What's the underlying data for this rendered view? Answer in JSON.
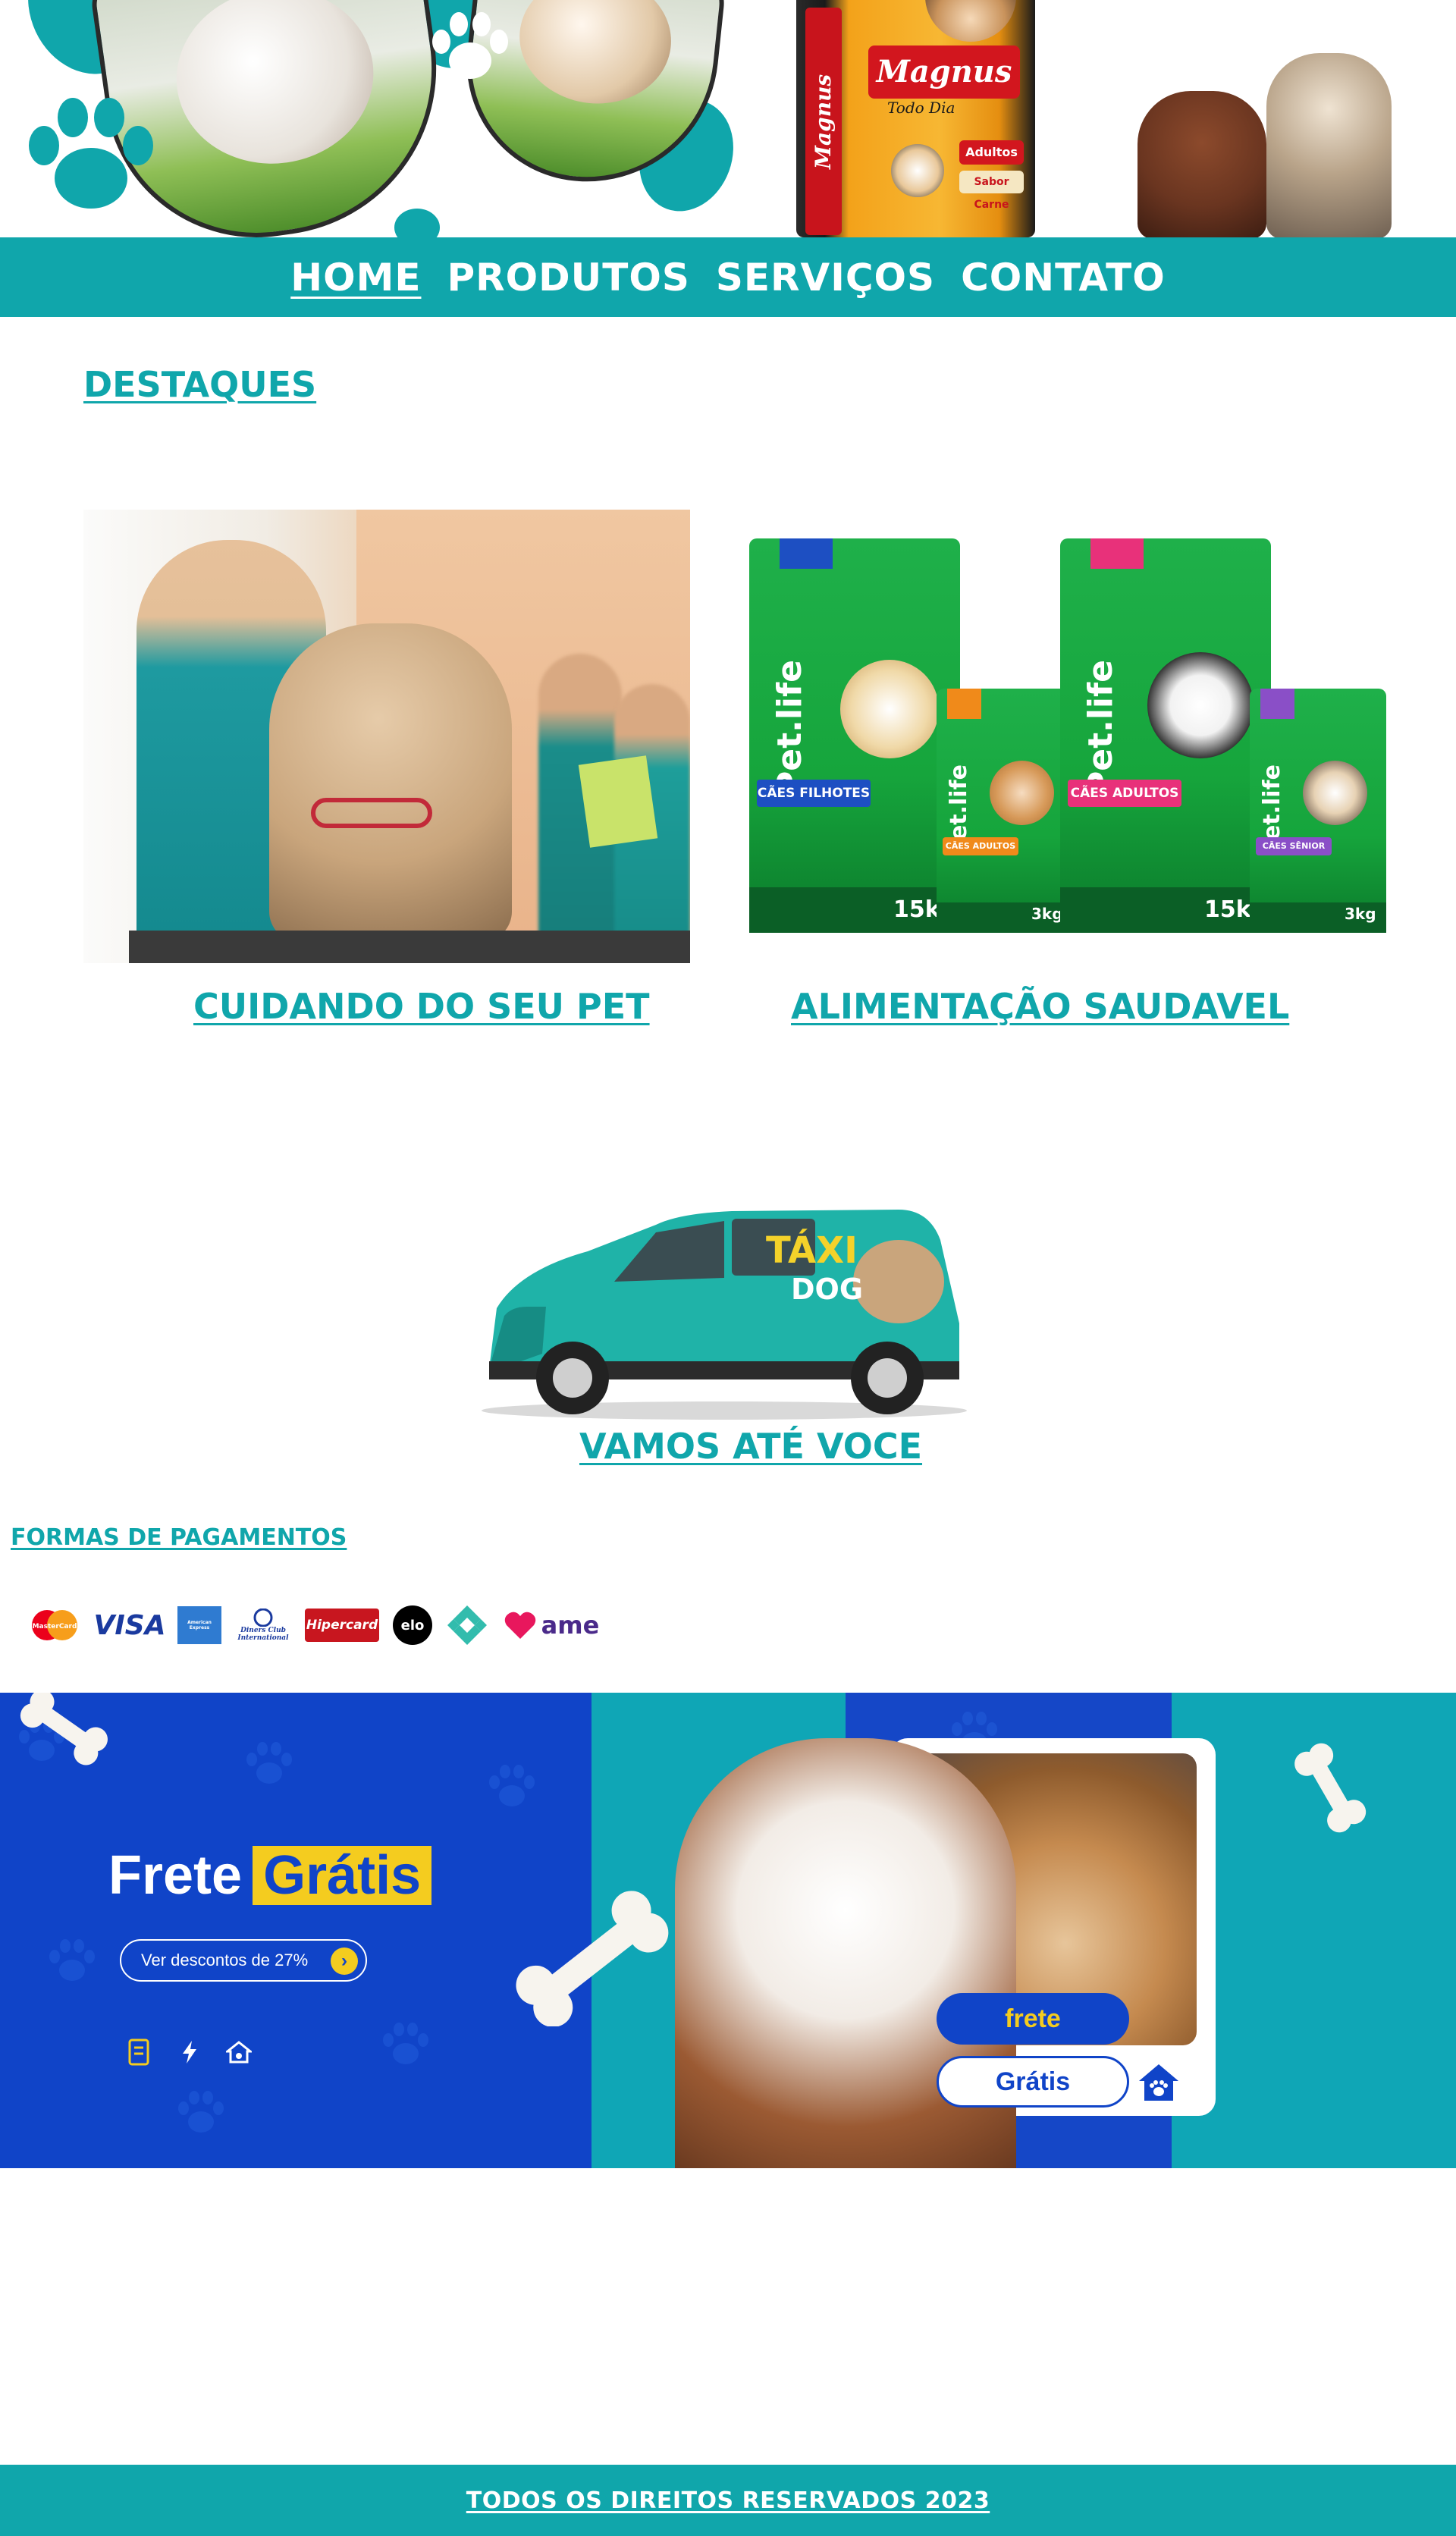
{
  "nav": {
    "items": [
      "Home",
      "Produtos",
      "Serviços",
      "Contato"
    ]
  },
  "banner": {
    "bag_brand": "Magnus",
    "bag_sub": "Todo Dia",
    "bag_label_1": "Adultos",
    "bag_label_2": "Sabor Carne"
  },
  "content": {
    "section_title": "Destaques",
    "card1_link": "Cuidando do seu pet",
    "card2_link": "Alimentação saudavel",
    "van_text_1": "TÁXI",
    "van_text_2": "DOG",
    "van_link": "Vamos  até voce",
    "products": [
      {
        "brand": "Pet.life",
        "label": "CÃES FILHOTES",
        "weight": "15kg"
      },
      {
        "brand": "Pet.life",
        "label": "CÃES ADULTOS",
        "weight": "3kg"
      },
      {
        "brand": "Pet.life",
        "label": "CÃES ADULTOS",
        "weight": "15kg"
      },
      {
        "brand": "Pet.life",
        "label": "CÃES SÊNIOR",
        "weight": "3kg"
      }
    ]
  },
  "payments": {
    "title": "Formas de pagamentos",
    "methods": [
      "MasterCard",
      "VISA",
      "American Express",
      "Diners Club International",
      "Hipercard",
      "elo",
      "Pix",
      "ame"
    ]
  },
  "promo": {
    "frete": "Frete",
    "gratis": "Grátis",
    "button": "Ver descontos de 27%",
    "pill_frete": "frete",
    "pill_gratis": "Grátis"
  },
  "footer": {
    "text": "Todos os direitos reservados 2023"
  },
  "colors": {
    "teal": "#10a6ab",
    "promo_blue": "#1044c8",
    "promo_yellow": "#f4cc1f"
  }
}
